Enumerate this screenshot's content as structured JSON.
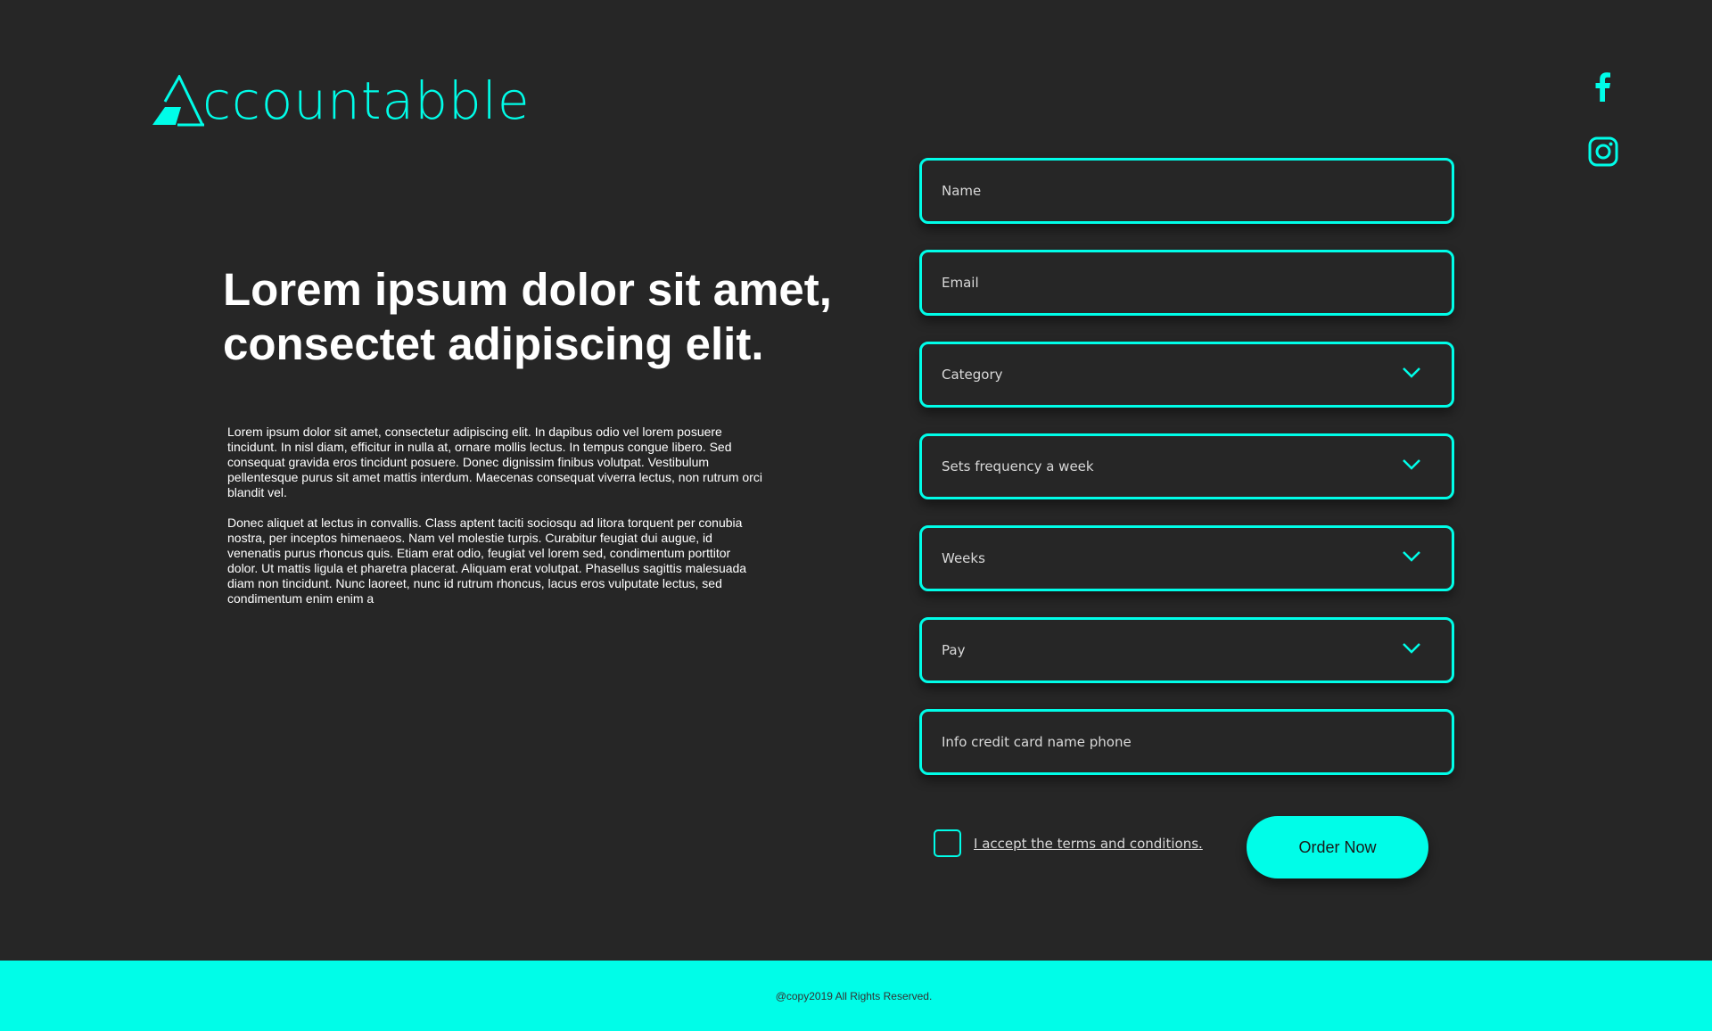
{
  "brand": {
    "logo_text": "ccountabble",
    "logo_icon": "a-triangle-logo",
    "accent_color": "#00fde8",
    "background_color": "#262626"
  },
  "social": {
    "facebook_icon": "facebook-icon",
    "instagram_icon": "instagram-icon"
  },
  "hero": {
    "headline_line1": "Lorem ipsum dolor sit amet,",
    "headline_line2": "consectet adipiscing elit.",
    "paragraph1": "Lorem ipsum dolor sit amet, consectetur adipiscing elit. In dapibus odio vel lorem posuere tincidunt. In nisl diam, efficitur in nulla at, ornare mollis lectus. In tempus congue libero. Sed consequat gravida eros tincidunt posuere. Donec dignissim finibus volutpat. Vestibulum pellentesque purus sit amet mattis interdum. Maecenas consequat viverra lectus, non rutrum orci blandit vel.",
    "paragraph2": "Donec aliquet at lectus in convallis. Class aptent taciti sociosqu ad litora torquent per conubia nostra, per inceptos himenaeos. Nam vel molestie turpis. Curabitur feugiat dui augue, id venenatis purus rhoncus quis. Etiam erat odio, feugiat vel lorem sed, condimentum porttitor dolor. Ut mattis ligula et pharetra placerat. Aliquam erat volutpat. Phasellus sagittis malesuada diam non tincidunt. Nunc laoreet, nunc id rutrum rhoncus, lacus eros vulputate lectus, sed condimentum enim enim a"
  },
  "form": {
    "name_placeholder": "Name",
    "email_placeholder": "Email",
    "category_placeholder": "Category",
    "frequency_placeholder": "Sets frequency a week",
    "weeks_placeholder": "Weeks",
    "pay_placeholder": "Pay",
    "info_placeholder": "Info credit card name phone",
    "terms_label": "I accept the terms and conditions.",
    "terms_checked": false,
    "submit_label": "Order Now"
  },
  "footer": {
    "copyright": "@copy2019 All Rights Reserved."
  }
}
